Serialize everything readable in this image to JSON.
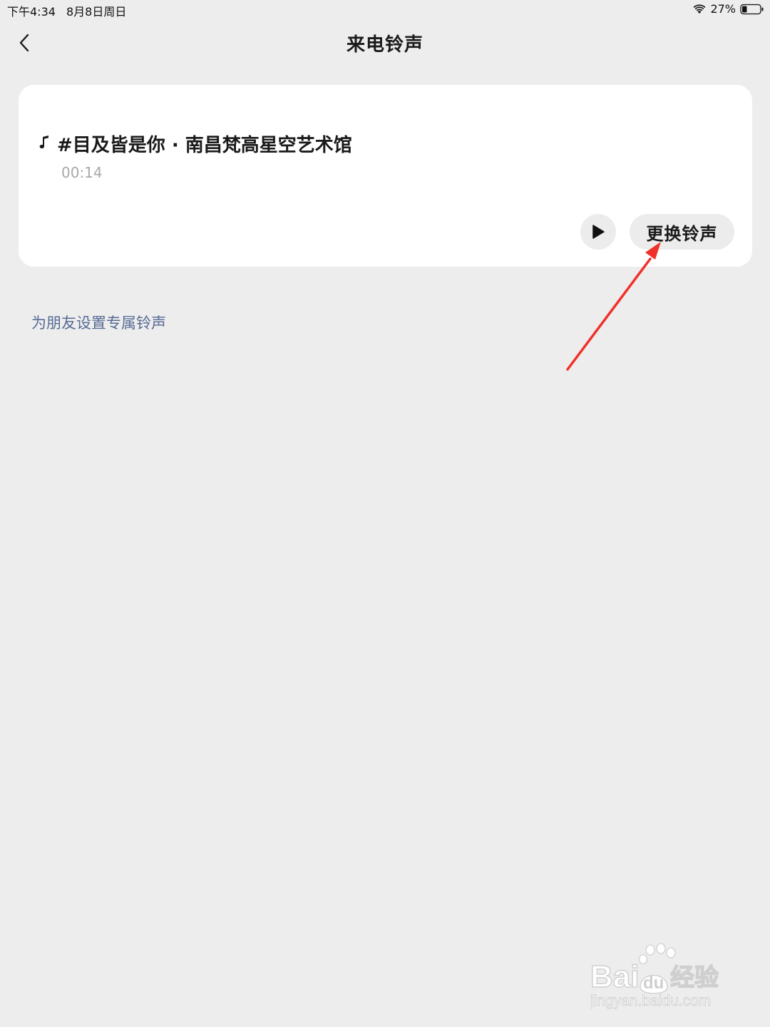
{
  "status_bar": {
    "time": "下午4:34",
    "date": "8月8日周日",
    "battery_percent": "27%",
    "battery_level": 0.27
  },
  "nav": {
    "back_icon": "chevron-left-icon",
    "title": "来电铃声"
  },
  "ringtone": {
    "icon": "music-note-icon",
    "name": "#目及皆是你 · 南昌梵高星空艺术馆",
    "duration": "00:14",
    "play_icon": "play-icon",
    "change_label": "更换铃声"
  },
  "friend_link": {
    "label": "为朋友设置专属铃声"
  },
  "annotation": {
    "color": "#f0312a"
  },
  "watermark": {
    "brand": "Bai du 经验",
    "url": "jingyan.baidu.com"
  },
  "colors": {
    "background": "#ededed",
    "card": "#ffffff",
    "link": "#576b95",
    "muted": "#a9a9a9"
  }
}
